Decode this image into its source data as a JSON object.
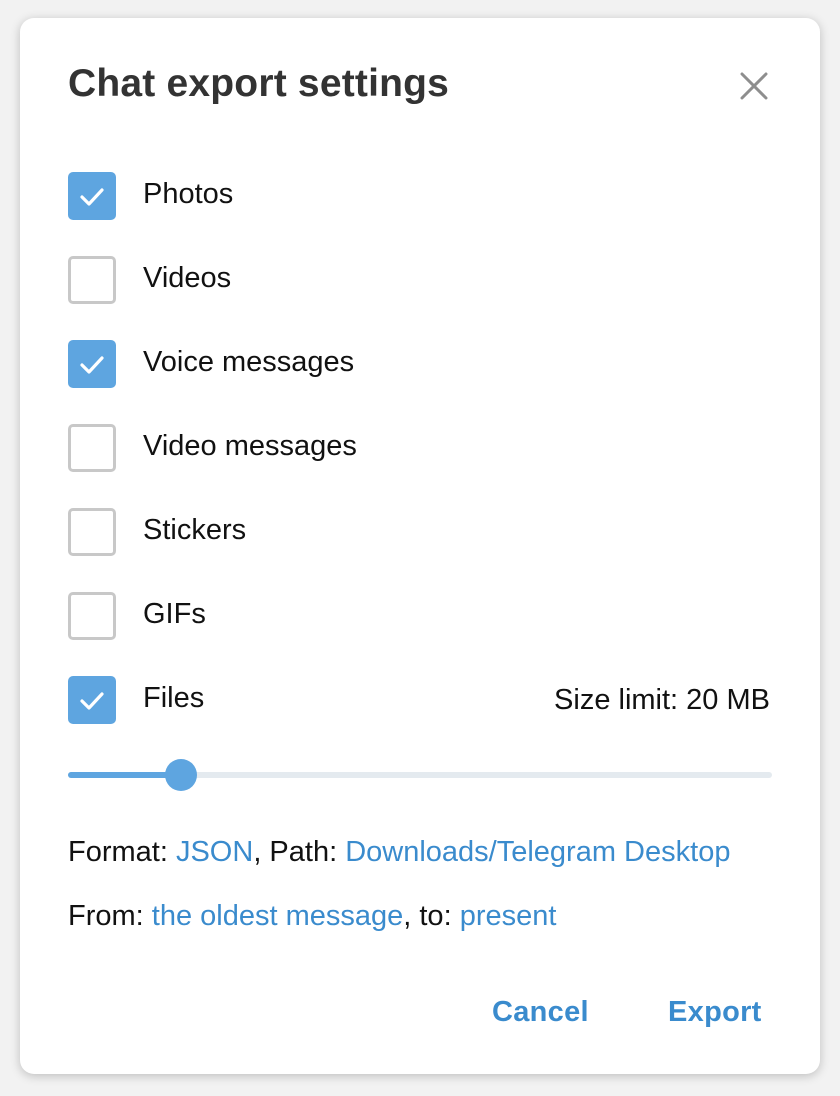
{
  "dialog": {
    "title": "Chat export settings",
    "close_icon": "close-icon"
  },
  "options": [
    {
      "label": "Photos",
      "checked": true
    },
    {
      "label": "Videos",
      "checked": false
    },
    {
      "label": "Voice messages",
      "checked": true
    },
    {
      "label": "Video messages",
      "checked": false
    },
    {
      "label": "Stickers",
      "checked": false
    },
    {
      "label": "GIFs",
      "checked": false
    },
    {
      "label": "Files",
      "checked": true
    }
  ],
  "size_limit": {
    "text": "Size limit: 20 MB",
    "slider_fraction": 0.16
  },
  "format_line": {
    "format_prefix": "Format: ",
    "format_value": "JSON",
    "path_prefix": ", Path: ",
    "path_value": "Downloads/Telegram Desktop"
  },
  "range_line": {
    "from_prefix": "From: ",
    "from_value": "the oldest message",
    "to_prefix": ", to: ",
    "to_value": "present"
  },
  "buttons": {
    "cancel": "Cancel",
    "export": "Export"
  },
  "colors": {
    "accent": "#5ea5e0",
    "link": "#3a8bcd",
    "checkbox_border": "#c8c8c8"
  }
}
